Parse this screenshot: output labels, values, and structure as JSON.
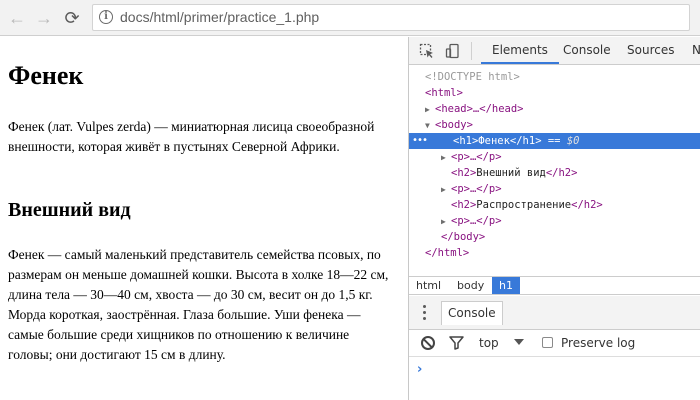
{
  "browser": {
    "url": "docs/html/primer/practice_1.php",
    "back_icon": "←",
    "forward_icon": "→",
    "reload_icon": "⟳",
    "info_icon": "i"
  },
  "page": {
    "h1": "Фенек",
    "p1": "Фенек (лат. Vulpes zerda) — миниатюрная лисица своеобразной внешности, которая живёт в пустынях Северной Африки.",
    "h2": "Внешний вид",
    "p2": "Фенек — самый маленький представитель семейства псовых, по размерам он меньше домашней кошки. Высота в холке 18—22 см, длина тела — 30—40 см, хвоста — до 30 см, весит он до 1,5 кг. Морда короткая, заострённая. Глаза большие. Уши фенека — самые большие среди хищников по отношению к величине головы; они достигают 15 см в длину."
  },
  "devtools": {
    "tabs": [
      "Elements",
      "Console",
      "Sources",
      "N"
    ],
    "tree": {
      "doctype": "<!DOCTYPE html>",
      "html_open": "<html>",
      "head": "<head>…</head>",
      "body_open": "<body>",
      "h1_open": "<h1>",
      "h1_text": "Фенек",
      "h1_close": "</h1>",
      "h1_eq": " == ",
      "h1_dollar": "$0",
      "p1": "<p>…</p>",
      "h2a_open": "<h2>",
      "h2a_text": "Внешний вид",
      "h2a_close": "</h2>",
      "p2": "<p>…</p>",
      "h2b_open": "<h2>",
      "h2b_text": "Распространение",
      "h2b_close": "</h2>",
      "p3": "<p>…</p>",
      "body_close": "</body>",
      "html_close": "</html>",
      "ellipsis": "•••"
    },
    "breadcrumbs": [
      "html",
      "body",
      "h1"
    ],
    "drawer_tab": "Console",
    "console": {
      "context": "top",
      "preserve_log": "Preserve log",
      "prompt": "›"
    },
    "colors": {
      "accent": "#3879d9",
      "tag": "#881280"
    }
  }
}
